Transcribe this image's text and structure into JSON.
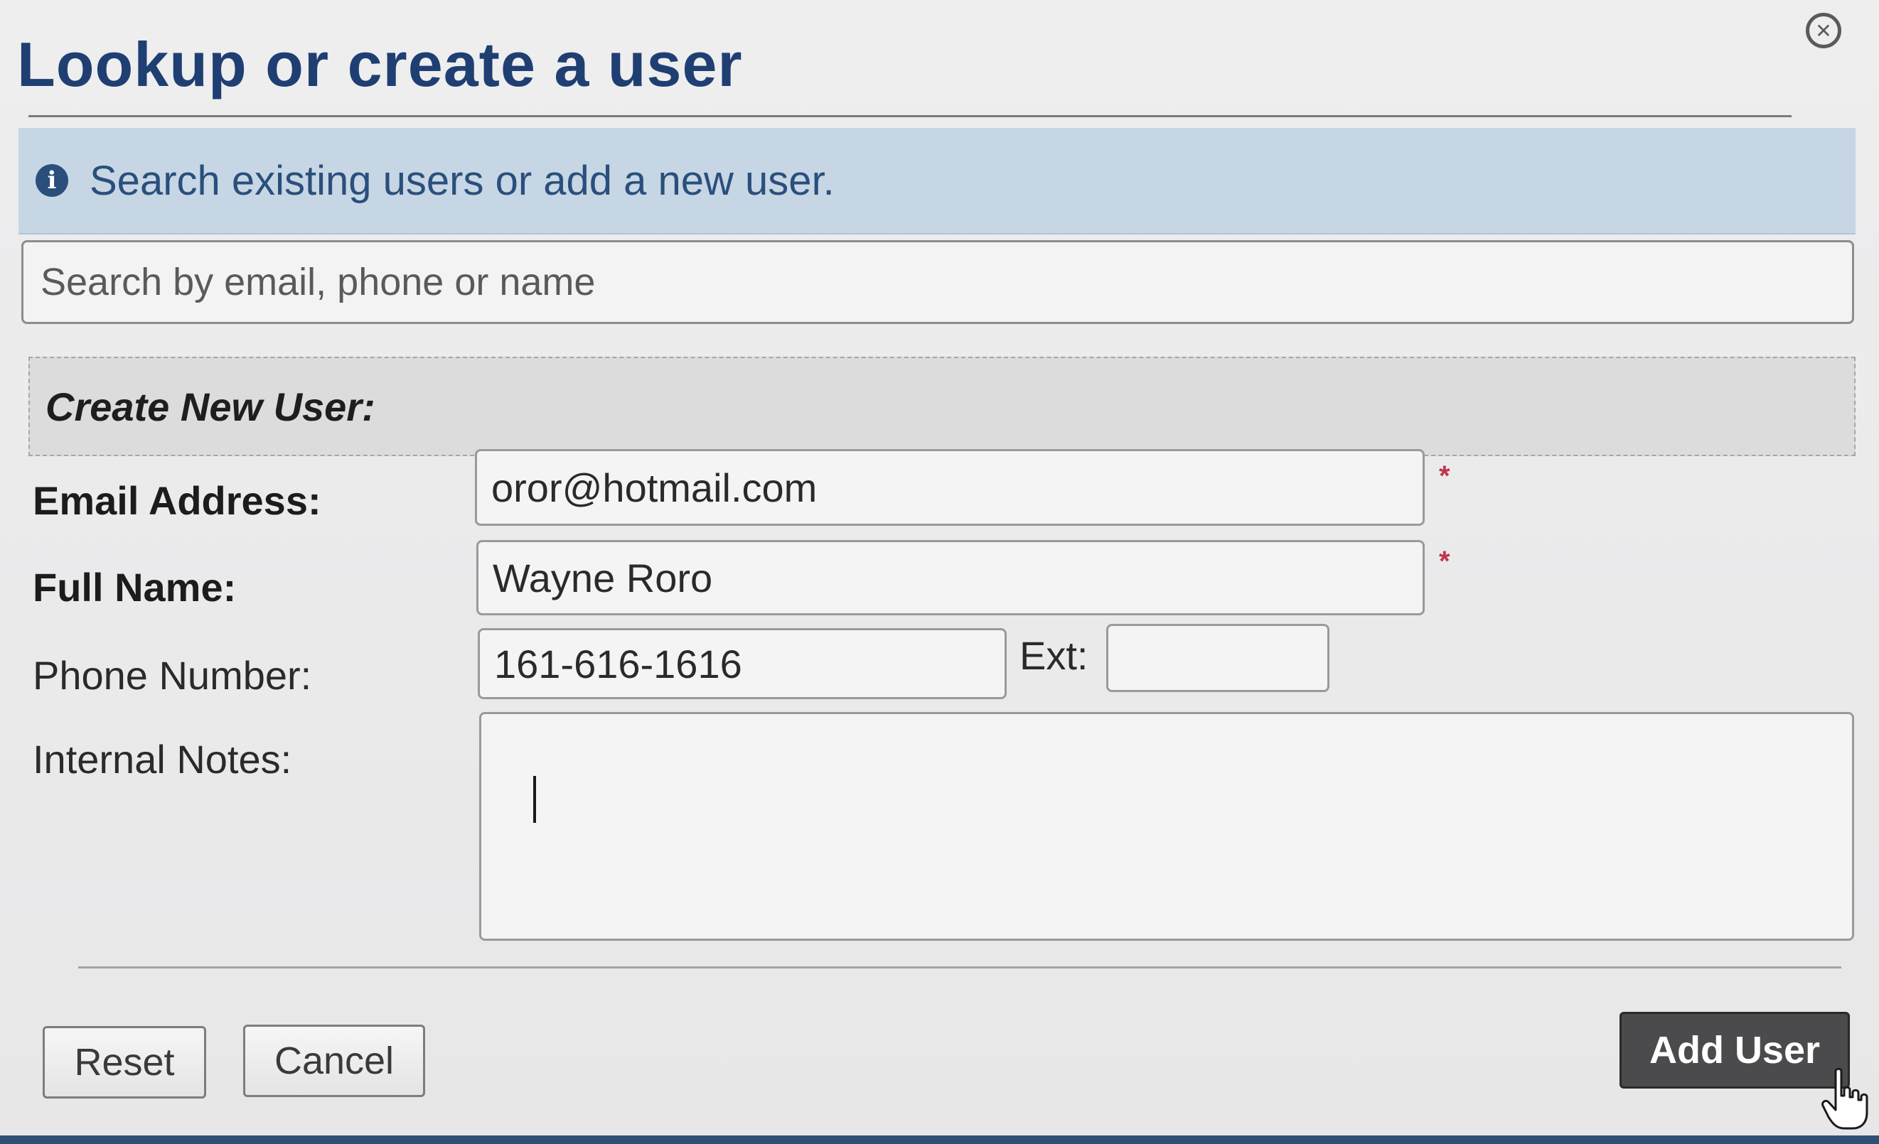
{
  "dialog": {
    "title": "Lookup or create a user",
    "close_icon": "close-circle-icon"
  },
  "info": {
    "icon": "info-icon",
    "message": "Search existing users or add a new user."
  },
  "search": {
    "placeholder": "Search by email, phone or name",
    "value": ""
  },
  "form": {
    "section_title": "Create New User:",
    "email": {
      "label": "Email Address:",
      "value": "oror@hotmail.com",
      "required_mark": "*"
    },
    "full_name": {
      "label": "Full Name:",
      "value": "Wayne Roro",
      "required_mark": "*"
    },
    "phone": {
      "label": "Phone Number:",
      "value": "161-616-1616",
      "ext_label": "Ext:",
      "ext_value": ""
    },
    "notes": {
      "label": "Internal Notes:",
      "value": ""
    }
  },
  "buttons": {
    "reset": "Reset",
    "cancel": "Cancel",
    "add_user": "Add User"
  },
  "colors": {
    "title": "#1f3f73",
    "info_bg": "#c7d6e4",
    "required": "#c2334a",
    "primary_button": "#4b4b4d"
  }
}
